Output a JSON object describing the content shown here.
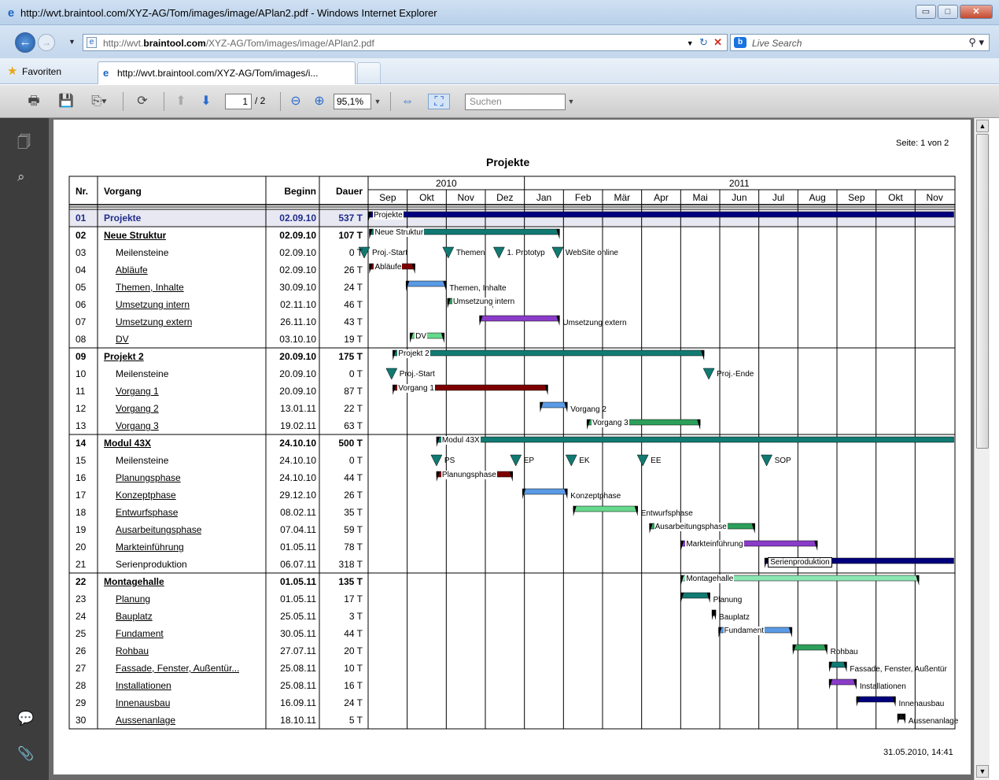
{
  "window": {
    "title": "http://wvt.braintool.com/XYZ-AG/Tom/images/image/APlan2.pdf - Windows Internet Explorer",
    "minimize": "▭",
    "maximize": "□",
    "close": "✕"
  },
  "address": {
    "prefix": "http://wvt.",
    "domain": "braintool.com",
    "path": "/XYZ-AG/Tom/images/image/APlan2.pdf",
    "refresh": "↻",
    "stop": "✕"
  },
  "search": {
    "placeholder": "Live Search"
  },
  "favorites": {
    "label": "Favoriten"
  },
  "tab": {
    "title": "http://wvt.braintool.com/XYZ-AG/Tom/images/i..."
  },
  "pdf_toolbar": {
    "page_current": "1",
    "page_total": "/ 2",
    "zoom": "95,1%",
    "find_placeholder": "Suchen"
  },
  "page": {
    "seite": "Seite:  1 von  2",
    "title": "Projekte",
    "footer": "31.05.2010, 14:41"
  },
  "gantt": {
    "headers": {
      "nr": "Nr.",
      "vorgang": "Vorgang",
      "beginn": "Beginn",
      "dauer": "Dauer"
    },
    "years": [
      "2010",
      "2011"
    ],
    "months": [
      "Sep",
      "Okt",
      "Nov",
      "Dez",
      "Jan",
      "Feb",
      "Mär",
      "Apr",
      "Mai",
      "Jun",
      "Jul",
      "Aug",
      "Sep",
      "Okt",
      "Nov"
    ],
    "rows": [
      {
        "nr": "01",
        "name": "Projekte",
        "begin": "02.09.10",
        "dur": "537 T",
        "kind": "top"
      },
      {
        "nr": "02",
        "name": "Neue Struktur",
        "begin": "02.09.10",
        "dur": "107 T",
        "kind": "group"
      },
      {
        "nr": "03",
        "name": "Meilensteine",
        "begin": "02.09.10",
        "dur": "0 T",
        "kind": "ms"
      },
      {
        "nr": "04",
        "name": "Abläufe",
        "begin": "02.09.10",
        "dur": "26 T",
        "kind": "task"
      },
      {
        "nr": "05",
        "name": "Themen, Inhalte",
        "begin": "30.09.10",
        "dur": "24 T",
        "kind": "task"
      },
      {
        "nr": "06",
        "name": "Umsetzung intern",
        "begin": "02.11.10",
        "dur": "46 T",
        "kind": "task"
      },
      {
        "nr": "07",
        "name": "Umsetzung extern",
        "begin": "26.11.10",
        "dur": "43 T",
        "kind": "task"
      },
      {
        "nr": "08",
        "name": "DV",
        "begin": "03.10.10",
        "dur": "19 T",
        "kind": "task"
      },
      {
        "nr": "09",
        "name": "Projekt 2",
        "begin": "20.09.10",
        "dur": "175 T",
        "kind": "group"
      },
      {
        "nr": "10",
        "name": "Meilensteine",
        "begin": "20.09.10",
        "dur": "0 T",
        "kind": "ms"
      },
      {
        "nr": "11",
        "name": "Vorgang 1",
        "begin": "20.09.10",
        "dur": "87 T",
        "kind": "task"
      },
      {
        "nr": "12",
        "name": "Vorgang 2",
        "begin": "13.01.11",
        "dur": "22 T",
        "kind": "task"
      },
      {
        "nr": "13",
        "name": "Vorgang 3",
        "begin": "19.02.11",
        "dur": "63 T",
        "kind": "task"
      },
      {
        "nr": "14",
        "name": "Modul 43X",
        "begin": "24.10.10",
        "dur": "500 T",
        "kind": "group"
      },
      {
        "nr": "15",
        "name": "Meilensteine",
        "begin": "24.10.10",
        "dur": "0 T",
        "kind": "ms"
      },
      {
        "nr": "16",
        "name": "Planungsphase",
        "begin": "24.10.10",
        "dur": "44 T",
        "kind": "task"
      },
      {
        "nr": "17",
        "name": "Konzeptphase",
        "begin": "29.12.10",
        "dur": "26 T",
        "kind": "task"
      },
      {
        "nr": "18",
        "name": "Entwurfsphase",
        "begin": "08.02.11",
        "dur": "35 T",
        "kind": "task"
      },
      {
        "nr": "19",
        "name": "Ausarbeitungsphase",
        "begin": "07.04.11",
        "dur": "59 T",
        "kind": "task"
      },
      {
        "nr": "20",
        "name": "Markteinführung",
        "begin": "01.05.11",
        "dur": "78 T",
        "kind": "task"
      },
      {
        "nr": "21",
        "name": "Serienproduktion",
        "begin": "06.07.11",
        "dur": "318 T",
        "kind": "plain"
      },
      {
        "nr": "22",
        "name": "Montagehalle",
        "begin": "01.05.11",
        "dur": "135 T",
        "kind": "group"
      },
      {
        "nr": "23",
        "name": "Planung",
        "begin": "01.05.11",
        "dur": "17 T",
        "kind": "task"
      },
      {
        "nr": "24",
        "name": "Bauplatz",
        "begin": "25.05.11",
        "dur": "3 T",
        "kind": "task"
      },
      {
        "nr": "25",
        "name": "Fundament",
        "begin": "30.05.11",
        "dur": "44 T",
        "kind": "task"
      },
      {
        "nr": "26",
        "name": "Rohbau",
        "begin": "27.07.11",
        "dur": "20 T",
        "kind": "task"
      },
      {
        "nr": "27",
        "name": "Fassade, Fenster, Außentür...",
        "begin": "25.08.11",
        "dur": "10 T",
        "kind": "task"
      },
      {
        "nr": "28",
        "name": "Installationen",
        "begin": "25.08.11",
        "dur": "16 T",
        "kind": "task"
      },
      {
        "nr": "29",
        "name": "Innenausbau",
        "begin": "16.09.11",
        "dur": "24 T",
        "kind": "task"
      },
      {
        "nr": "30",
        "name": "Aussenanlage",
        "begin": "18.10.11",
        "dur": "5 T",
        "kind": "task"
      }
    ],
    "bars": [
      {
        "row": 0,
        "start": 0.0,
        "end": 14.99,
        "color": "#00007d",
        "label": "Projekte",
        "label_pos": "in"
      },
      {
        "row": 1,
        "start": 0.03,
        "end": 4.9,
        "color": "#117a72",
        "label": "Neue Struktur",
        "label_pos": "in"
      },
      {
        "row": 3,
        "start": 0.03,
        "end": 1.2,
        "color": "#7d0000",
        "label": "Abläufe",
        "label_pos": "in"
      },
      {
        "row": 4,
        "start": 0.97,
        "end": 2.0,
        "color": "#5a9be6",
        "label": "Themen, Inhalte",
        "label_pos": "right"
      },
      {
        "row": 5,
        "start": 2.03,
        "end": 3.2,
        "color": "#2d9f5a",
        "label": "Umsetzung intern",
        "label_pos": "in"
      },
      {
        "row": 6,
        "start": 2.85,
        "end": 4.9,
        "color": "#8a3cc9",
        "label": "Umsetzung extern",
        "label_pos": "right"
      },
      {
        "row": 7,
        "start": 1.07,
        "end": 1.95,
        "color": "#66d98c",
        "label": "DV",
        "label_pos": "in"
      },
      {
        "row": 8,
        "start": 0.63,
        "end": 8.6,
        "color": "#117a72",
        "label": "Projekt 2",
        "label_pos": "in"
      },
      {
        "row": 10,
        "start": 0.63,
        "end": 4.6,
        "color": "#7d0000",
        "label": "Vorgang 1",
        "label_pos": "in"
      },
      {
        "row": 11,
        "start": 4.4,
        "end": 5.1,
        "color": "#5a9be6",
        "label": "Vorgang 2",
        "label_pos": "right"
      },
      {
        "row": 12,
        "start": 5.6,
        "end": 8.5,
        "color": "#2d9f5a",
        "label": "Vorgang 3",
        "label_pos": "in"
      },
      {
        "row": 13,
        "start": 1.75,
        "end": 14.99,
        "color": "#117a72",
        "label": "Modul 43X",
        "label_pos": "in"
      },
      {
        "row": 15,
        "start": 1.75,
        "end": 3.7,
        "color": "#7d0000",
        "label": "Planungsphase",
        "label_pos": "in"
      },
      {
        "row": 16,
        "start": 3.95,
        "end": 5.1,
        "color": "#5a9be6",
        "label": "Konzeptphase",
        "label_pos": "right"
      },
      {
        "row": 17,
        "start": 5.25,
        "end": 6.9,
        "color": "#66d98c",
        "label": "Entwurfsphase",
        "label_pos": "right"
      },
      {
        "row": 18,
        "start": 7.2,
        "end": 9.9,
        "color": "#2d9f5a",
        "label": "Ausarbeitungsphase",
        "label_pos": "in"
      },
      {
        "row": 19,
        "start": 8.0,
        "end": 11.5,
        "color": "#8a3cc9",
        "label": "Markteinführung",
        "label_pos": "in"
      },
      {
        "row": 20,
        "start": 10.15,
        "end": 14.99,
        "color": "#00007d",
        "label": "Serienproduktion",
        "label_pos": "box"
      },
      {
        "row": 21,
        "start": 8.0,
        "end": 14.1,
        "color": "#8ce6b4",
        "label": "Montagehalle",
        "label_pos": "in"
      },
      {
        "row": 22,
        "start": 8.0,
        "end": 8.75,
        "color": "#117a72",
        "label": "Planung",
        "label_pos": "right"
      },
      {
        "row": 23,
        "start": 8.8,
        "end": 8.9,
        "color": "#111111",
        "label": "Bauplatz",
        "label_pos": "right"
      },
      {
        "row": 24,
        "start": 8.97,
        "end": 10.85,
        "color": "#5a9be6",
        "label": "Fundament",
        "label_pos": "in"
      },
      {
        "row": 25,
        "start": 10.87,
        "end": 11.75,
        "color": "#2d9f5a",
        "label": "Rohbau",
        "label_pos": "right"
      },
      {
        "row": 26,
        "start": 11.8,
        "end": 12.25,
        "color": "#117a72",
        "label": "Fassade, Fenster, Außentür",
        "label_pos": "right"
      },
      {
        "row": 27,
        "start": 11.8,
        "end": 12.5,
        "color": "#8a3cc9",
        "label": "Installationen",
        "label_pos": "right"
      },
      {
        "row": 28,
        "start": 12.5,
        "end": 13.5,
        "color": "#00007d",
        "label": "Innenausbau",
        "label_pos": "right"
      },
      {
        "row": 29,
        "start": 13.55,
        "end": 13.75,
        "color": "#111111",
        "label": "Aussenanlage",
        "label_pos": "right"
      }
    ],
    "milestones": [
      {
        "row": 2,
        "pos": -0.1,
        "label": "Proj.-Start"
      },
      {
        "row": 2,
        "pos": 2.05,
        "label": "Themen"
      },
      {
        "row": 2,
        "pos": 3.35,
        "label": "1. Prototyp"
      },
      {
        "row": 2,
        "pos": 4.85,
        "label": "WebSite online"
      },
      {
        "row": 9,
        "pos": 0.6,
        "label": "Proj.-Start"
      },
      {
        "row": 9,
        "pos": 8.72,
        "label": "Proj.-Ende"
      },
      {
        "row": 14,
        "pos": 1.75,
        "label": "PS"
      },
      {
        "row": 14,
        "pos": 3.78,
        "label": "EP"
      },
      {
        "row": 14,
        "pos": 5.2,
        "label": "EK"
      },
      {
        "row": 14,
        "pos": 7.03,
        "label": "EE"
      },
      {
        "row": 14,
        "pos": 10.2,
        "label": "SOP"
      }
    ]
  }
}
